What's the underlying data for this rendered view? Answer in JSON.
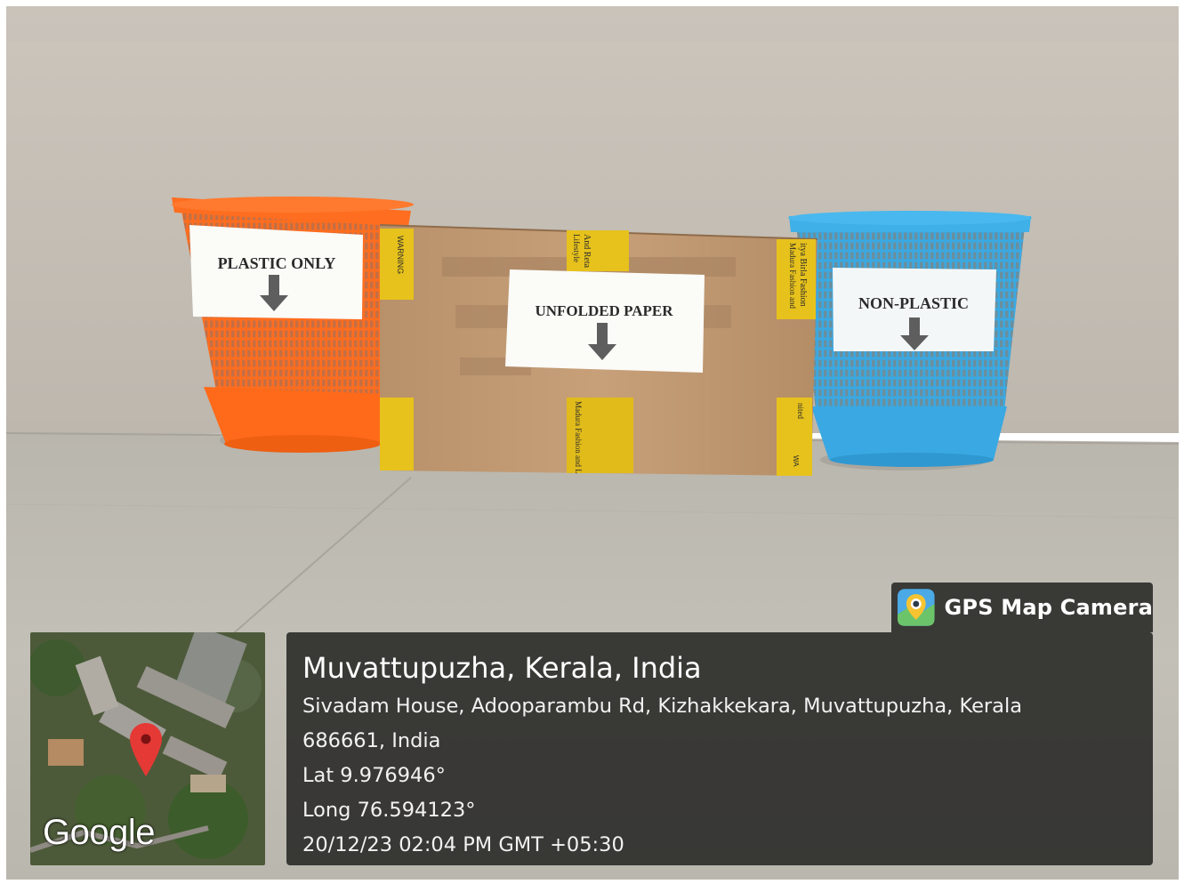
{
  "photo": {
    "labels": {
      "left_bin": "PLASTIC ONLY",
      "center_box": "UNFOLDED PAPER",
      "right_bin": "NON-PLASTIC"
    },
    "bin_colors": {
      "left": "#ff6a1a",
      "center": "#c19a70",
      "right": "#35a6e0"
    },
    "tape_texts": [
      "WARNING",
      "And Reta",
      "Lifestyle",
      "itya Birla Fashion",
      "Madura Fashion and",
      "Madura Fashion and L",
      "nited",
      "WA"
    ]
  },
  "overlay": {
    "app_name": "GPS Map Camera",
    "app_icon": "map-pin-camera-icon",
    "map_brand": "Google",
    "title": "Muvattupuzha, Kerala, India",
    "address_line1": "Sivadam House, Adooparambu Rd, Kizhakkekara, Muvattupuzha, Kerala",
    "address_line2": "686661, India",
    "latitude": "Lat 9.976946°",
    "longitude": "Long 76.594123°",
    "timestamp": "20/12/23 02:04 PM GMT +05:30",
    "panel_color": "#2e2e2c"
  }
}
